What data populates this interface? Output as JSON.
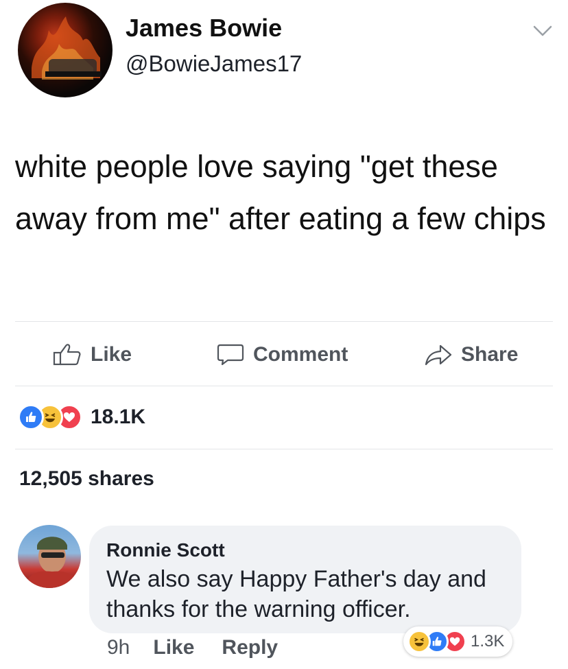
{
  "post": {
    "author": {
      "name": "James Bowie",
      "handle": "@BowieJames17"
    },
    "text": "white people love saying \"get these away from me\" after eating a few chips",
    "actions": {
      "like": "Like",
      "comment": "Comment",
      "share": "Share"
    },
    "reactions": {
      "types": [
        "like",
        "haha",
        "love"
      ],
      "count": "18.1K"
    },
    "shares": "12,505 shares"
  },
  "comment": {
    "author": "Ronnie Scott",
    "text": "We also say Happy Father's day and thanks for the warning officer.",
    "time": "9h",
    "like_label": "Like",
    "reply_label": "Reply",
    "reactions": {
      "types": [
        "haha",
        "like",
        "love"
      ],
      "count": "1.3K"
    }
  },
  "colors": {
    "like_blue": "#2f7cf6",
    "haha_yellow": "#f7c23b",
    "love_red": "#f0404f",
    "secondary_text": "#50555c"
  },
  "icons": {
    "menu": "chevron-down-icon",
    "like": "thumbs-up-icon",
    "comment": "speech-bubble-icon",
    "share": "share-arrow-icon"
  }
}
